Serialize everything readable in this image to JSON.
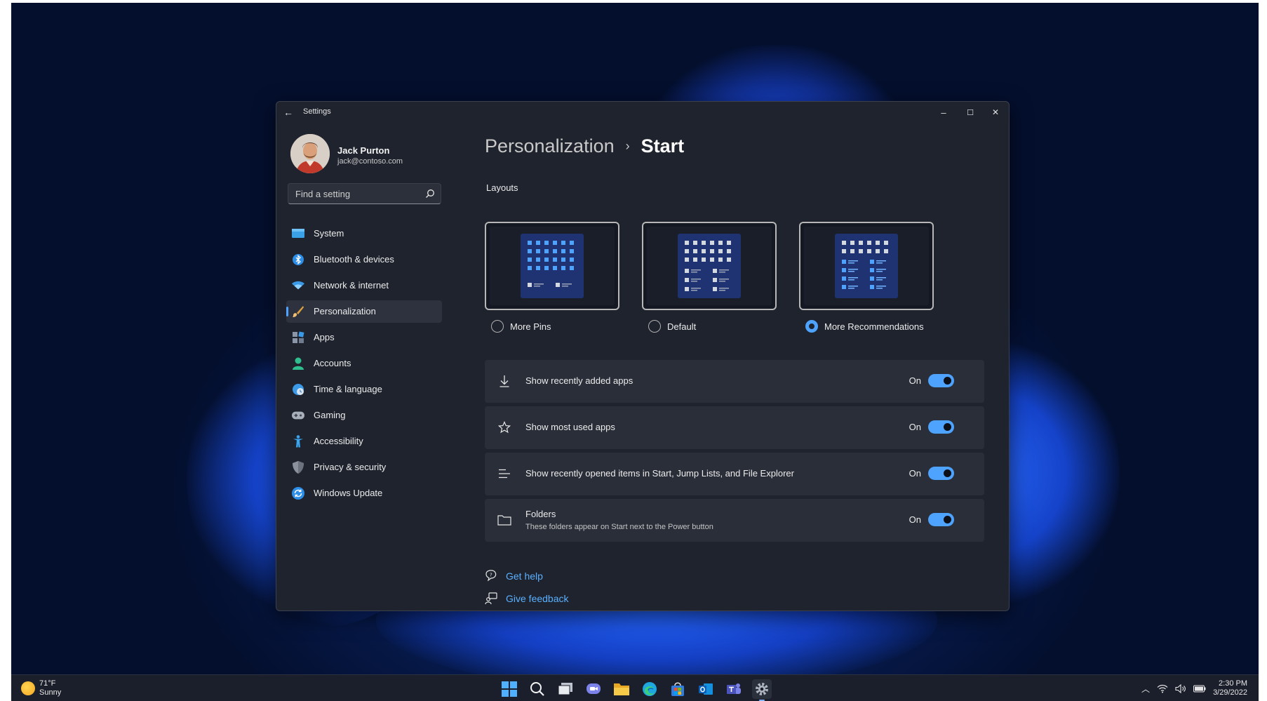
{
  "window": {
    "title": "Settings",
    "controls": {
      "minimize": "–",
      "maximize": "☐",
      "close": "✕"
    }
  },
  "user": {
    "name": "Jack Purton",
    "email": "jack@contoso.com"
  },
  "search": {
    "placeholder": "Find a setting"
  },
  "sidebar": {
    "items": [
      {
        "label": "System",
        "icon": "system-icon"
      },
      {
        "label": "Bluetooth & devices",
        "icon": "bluetooth-icon"
      },
      {
        "label": "Network & internet",
        "icon": "wifi-icon"
      },
      {
        "label": "Personalization",
        "icon": "brush-icon",
        "selected": true
      },
      {
        "label": "Apps",
        "icon": "apps-icon"
      },
      {
        "label": "Accounts",
        "icon": "person-icon"
      },
      {
        "label": "Time & language",
        "icon": "clock-globe-icon"
      },
      {
        "label": "Gaming",
        "icon": "gamepad-icon"
      },
      {
        "label": "Accessibility",
        "icon": "accessibility-icon"
      },
      {
        "label": "Privacy & security",
        "icon": "shield-icon"
      },
      {
        "label": "Windows Update",
        "icon": "update-icon"
      }
    ]
  },
  "breadcrumb": {
    "parent": "Personalization",
    "separator": "›",
    "current": "Start"
  },
  "layouts": {
    "title": "Layouts",
    "options": [
      {
        "label": "More Pins",
        "selected": false
      },
      {
        "label": "Default",
        "selected": false
      },
      {
        "label": "More Recommendations",
        "selected": true
      }
    ]
  },
  "settings": [
    {
      "label": "Show recently added apps",
      "sub": "",
      "state": "On",
      "icon": "download-icon"
    },
    {
      "label": "Show most used apps",
      "sub": "",
      "state": "On",
      "icon": "star-icon"
    },
    {
      "label": "Show recently opened items in Start, Jump Lists, and File Explorer",
      "sub": "",
      "state": "On",
      "icon": "list-icon"
    },
    {
      "label": "Folders",
      "sub": "These folders appear on Start next to the Power button",
      "state": "On",
      "icon": "folder-icon"
    }
  ],
  "help": {
    "get_help": "Get help",
    "give_feedback": "Give feedback"
  },
  "taskbar": {
    "weather": {
      "temp": "71°F",
      "condition": "Sunny"
    },
    "clock": {
      "time": "2:30 PM",
      "date": "3/29/2022"
    }
  },
  "colors": {
    "accent": "#4ea3ff",
    "window_bg": "#1f232e",
    "card_bg": "#2a2e39",
    "link": "#5ab0ff"
  }
}
